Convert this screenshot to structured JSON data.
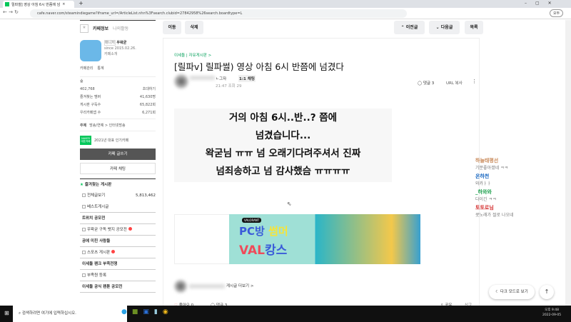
{
  "browser": {
    "tab_title": "릴파썰] 영상 아침 6시 반쯤에 넘",
    "new_tab": "+",
    "url": "cafe.naver.com/steamindiegame?iframe_url=/ArticleList.nhn%3Fsearch.clubid=27842958%26search.boardtype=L",
    "profile": "오두"
  },
  "sidebar": {
    "tab_info": "카페정보",
    "tab_activity": "나의활동",
    "manager_badge": "매니저",
    "manager": "우왁굳",
    "since": "since 2015.02.26.",
    "intro": "카페소개",
    "manage": "카페관리",
    "stats": "통계",
    "level": "숲",
    "members": "402,768",
    "invite": "초대하기",
    "fav_label": "즐겨찾는 멤버",
    "fav_value": "41,630명",
    "sub_label": "게시판 구독수",
    "sub_value": "65,822회",
    "app_label": "우리카페앱 수",
    "app_value": "6,271회",
    "topic_label": "주제",
    "topic": "방송/연예 > 인터넷방송",
    "award_badge": "NAVER 대표카페",
    "award": "2021년 대표 인기카페",
    "write": "카페 글쓰기",
    "chat": "카페 채팅",
    "fav_boards": "즐겨찾는 게시판",
    "menu": [
      {
        "label": "전체글보기",
        "count": "5,813,462",
        "chk": true,
        "bold": false
      },
      {
        "label": "베스트게시글",
        "chk": true
      },
      {
        "label": "트위치 공모전",
        "bold": true
      },
      {
        "label": "우왁굳 구독 뱃지 공모전",
        "chk": true,
        "new": true
      },
      {
        "label": "공에 미친 사람들",
        "bold": true
      },
      {
        "label": "스포츠 게시판",
        "chk": true,
        "new": true
      },
      {
        "label": "이세돌 팬크 부족전쟁",
        "bold": true
      },
      {
        "label": "부족원 등록",
        "chk": true
      },
      {
        "label": "이세돌 공식 팬툰 공모전",
        "bold": true
      }
    ]
  },
  "toolbar": {
    "move": "이동",
    "delete": "삭제",
    "prev": "이전글",
    "next": "다음글",
    "list": "목록"
  },
  "article": {
    "board": "이세돌 | 자유게시판 >",
    "title": "[릴파v] 릴파썰) 영상 아침 6시 반쯤에 넘겼다",
    "author_suffix": "ㄴ그자",
    "chat": "1:1 채팅",
    "time": "21:47",
    "views": "조회 29",
    "comments": "댓글 3",
    "url_copy": "URL 복사",
    "image_lines": [
      "거의 아침 6시..반..? 쯤에",
      "넘겼습니다...",
      "왁굳님 ㅠㅠ 넘 오래기다려주셔서 진짜",
      "넘죄송하고 넘 감사했슴 ㅠㅠㅠㅠ"
    ],
    "banner": {
      "tag": "VALORANT",
      "line1a": "PC방",
      "line1b": "썸머",
      "line2a": "VAL",
      "line2b": "캉스"
    },
    "more_posts": "게시글 더보기 >",
    "like": "좋아요 0",
    "comment": "댓글 3",
    "share": "공유",
    "report": "신고"
  },
  "chat_overlay": [
    {
      "name": "하늘태평선",
      "msg": "기분좋아졌네 ㅋㅋ",
      "color": "#c98a5a"
    },
    {
      "name": "온하천",
      "msg": "와카ㅏㅏ",
      "color": "#1565c0"
    },
    {
      "name": "_하와와",
      "msg": "다이긴 ㅋㅋ",
      "color": "#1a9e4a"
    },
    {
      "name": "토토로님",
      "msg": "콧노래가 절로 나오네",
      "color": "#d32f2f"
    }
  ],
  "floating": {
    "dark_mode": "다크 모드로 보기",
    "top": "↑"
  },
  "taskbar": {
    "search": "검색하려면 여기에 입력하십시오.",
    "time": "오후 9:48",
    "date": "2022-09-05"
  }
}
